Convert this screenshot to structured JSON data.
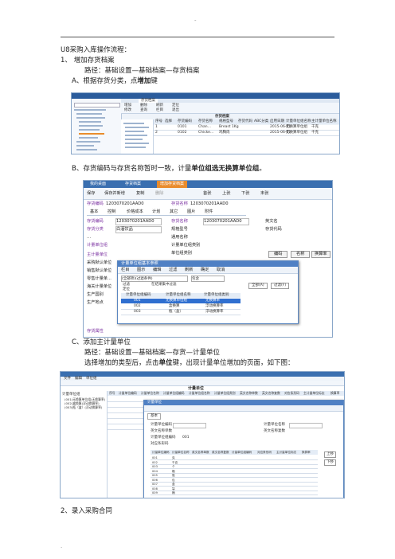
{
  "page": {
    "header_mark": "-",
    "footer_mark": ".",
    "title": "U8采购入库操作流程：",
    "step1": "1、 增加存货档案",
    "step1_path": "路径：基础设置—基础档案—存货档案",
    "stepA_pre": "A、根据存货分类，点",
    "stepA_bold": "增加",
    "stepA_post": "键",
    "stepB_pre": "B、存货编码与存货名称暂时一致，计量",
    "stepB_bold": "单位组选无换算单位组",
    "stepB_post": "。",
    "stepC": "C、添加主计量单位",
    "stepC_path": "路径：基础设置—基础档案—存货—计量单位",
    "stepC_desc_pre": "选择增加的类型后，点击",
    "stepC_desc_bold": "单位",
    "stepC_desc_post": "键，出现计量单位增加的页面，如下图：",
    "step2": "2、录入采购合同"
  },
  "shot1": {
    "tab": "存货档案",
    "grid_title": "存货档案",
    "toolbar": [
      "增加",
      "修改",
      "删除",
      "查询",
      "刷新",
      "栏目",
      "定位",
      "退出"
    ],
    "headers": [
      "序号",
      "选择",
      "存货编码",
      "存货名称",
      "规格型号",
      "存货代码",
      "ABC分类",
      "启用日期",
      "计量单位组名称",
      "主计量单位名称"
    ],
    "rows": [
      [
        "1",
        "",
        "0101",
        "Chan...",
        "Breast 1Kg",
        "",
        "",
        "2015-06-01",
        "无换算单位组",
        "千克"
      ],
      [
        "2",
        "",
        "0102",
        "Chicke...",
        "鸡胸肉",
        "",
        "",
        "2015-06-01",
        "无换算单位组",
        "千克"
      ]
    ]
  },
  "shot2": {
    "tabs": [
      "我的桌面",
      "存货档案",
      "增加存货档案"
    ],
    "toolbar": [
      "保存",
      "保存并新增",
      "复制",
      "删除",
      "首张",
      "上张",
      "下张",
      "末张"
    ],
    "code_label": "存货编码",
    "code_value": "1203070201AAD0",
    "name_label": "存货名称",
    "name_value": "1203070201AAD0",
    "subtabs": [
      "基本",
      "控制",
      "价格成本",
      "计划",
      "其它",
      "图片",
      "附件"
    ],
    "fields_left": [
      "存货编码",
      "存货分类",
      "计量单位组",
      "主计量单位",
      "采购默认单位",
      "销售默认单位",
      "零售计量单...",
      "海关计量单位",
      "生产国别",
      "生产地点"
    ],
    "field_values": {
      "code": "1203070201AAD0",
      "category": "白酒饮品",
      "name": "1203070201AAD0"
    },
    "fields_right": [
      "存货名称",
      "规格型号",
      "通用名称",
      "计量单位组类别",
      "单位组类别"
    ],
    "fields_far": [
      "英文名",
      "存货代码"
    ],
    "side_buttons": [
      "编码",
      "名称",
      "换算率"
    ],
    "dialog_title": "计量单位组基本参照",
    "dialog_toolbar": [
      "栏目",
      "图示",
      "编辑",
      "过滤",
      "刷新",
      "确定",
      "取消"
    ],
    "dialog_filter": "(全部项)(过滤条件)",
    "dialog_search": "包含",
    "dialog_options": [
      "过滤",
      "定位"
    ],
    "dialog_check": "在结果集中过滤",
    "dialog_buttons": [
      "全部(A)",
      "过滤(F)"
    ],
    "dialog_headers": [
      "计量单位组编码",
      "计量单位组名称",
      "计量单位组类别"
    ],
    "dialog_rows": [
      [
        "001",
        "无换算单位组",
        "无换算率"
      ],
      [
        "002",
        "盒换算",
        "浮动换算率"
      ],
      [
        "003",
        "瓶（盒）",
        "浮动换算率"
      ]
    ],
    "bottom_label": "存货属性"
  },
  "shot3": {
    "menu": [
      "文件",
      "编辑",
      "单位组"
    ],
    "window_title": "计量单位",
    "tree": [
      "计量单位组",
      "(001)无换算单位组(无换算率)",
      "(002)盒换算(浮动换算率)",
      "(003)瓶（盒）(浮动换算率)"
    ],
    "headers": [
      "序号",
      "计量单位编码",
      "计量单位名称",
      "计量单位组编码",
      "计量单位组名称",
      "计量单位组类别",
      "英文名称单数",
      "英文名称复数",
      "对应条形码",
      "主计量单位标志",
      "换算率"
    ],
    "dialog_title": "计量单位",
    "dialog_tab": "基本",
    "dialog_fields": [
      "计量单位编码",
      "英文名称单数",
      "计量单位组编码",
      "对应条形码"
    ],
    "dialog_fields_right": [
      "计量单位名称",
      "英文名称复数"
    ],
    "dialog_value": "001",
    "dialog_grid_headers": [
      "计量单位编码",
      "计量单位名称",
      "英文名称单数",
      "英文名称复数",
      "计量单位组编码",
      "对应条形码",
      "主计量单位标志",
      "换算率"
    ],
    "dialog_rows": [
      "001",
      "002",
      "003",
      "004",
      "005",
      "006",
      "007",
      "008",
      "009"
    ],
    "dialog_row_names": [
      "克",
      "千克",
      "个",
      "箱",
      "瓶",
      "包",
      "盒",
      "袋",
      "桶"
    ],
    "side_buttons": [
      "上移",
      "下移"
    ]
  },
  "colors": {
    "accent": "#1b4b9c",
    "orange": "#e98c2c",
    "purple": "#7a2fa0",
    "select": "#2f6fd0"
  }
}
